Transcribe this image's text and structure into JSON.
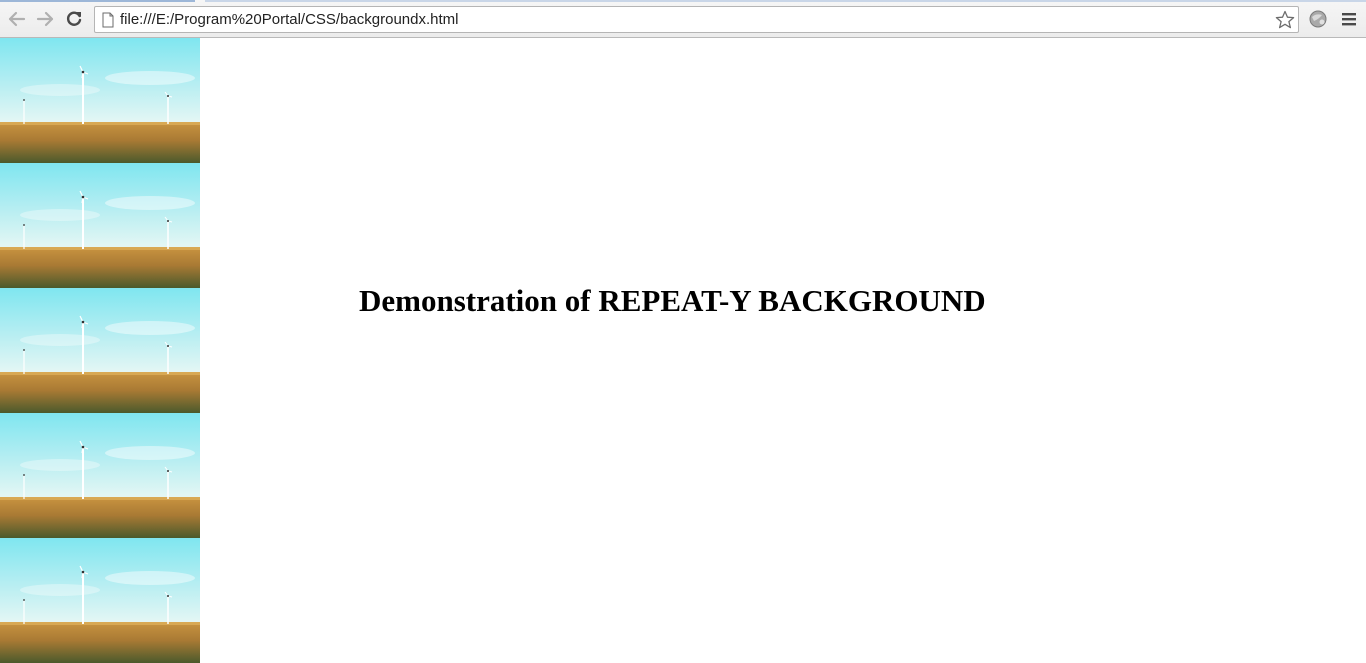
{
  "browser": {
    "url": "file:///E:/Program%20Portal/CSS/backgroundx.html",
    "icons": {
      "back": "back-arrow-icon",
      "forward": "forward-arrow-icon",
      "reload": "reload-icon",
      "page": "page-icon",
      "bookmark": "star-icon",
      "extension": "extension-icon",
      "menu": "hamburger-menu-icon"
    }
  },
  "page": {
    "heading": "Demonstration of REPEAT-Y BACKGROUND",
    "background_repeat": "repeat-y",
    "background_tile_count": 5,
    "colors": {
      "sky": "#7fe6f0",
      "field": "#c99440",
      "grass": "#4b5a2c"
    }
  }
}
